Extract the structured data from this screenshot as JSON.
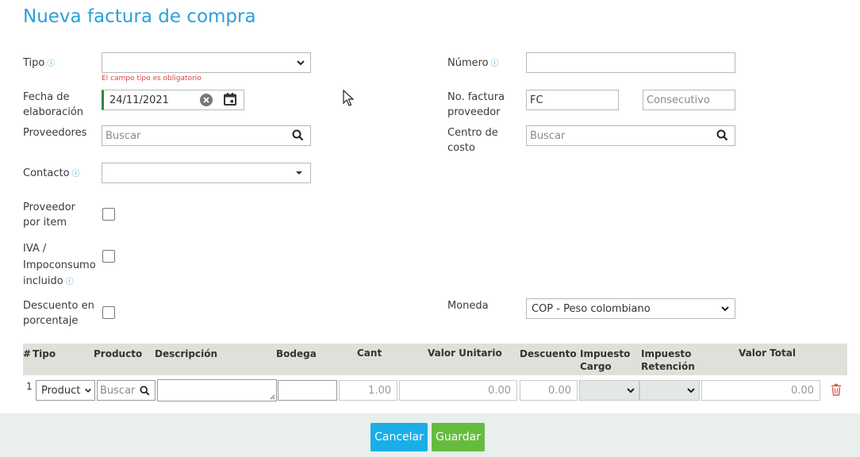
{
  "page": {
    "title": "Nueva factura de compra"
  },
  "form": {
    "tipo": {
      "label": "Tipo",
      "value": "",
      "error": "El campo tipo es obligatorio"
    },
    "fecha": {
      "label_line1": "Fecha de",
      "label_line2": "elaboración",
      "value": "24/11/2021"
    },
    "proveedores": {
      "label": "Proveedores",
      "placeholder": "Buscar"
    },
    "contacto": {
      "label": "Contacto",
      "value": ""
    },
    "proveedor_item": {
      "label_line1": "Proveedor",
      "label_line2": "por item",
      "checked": false
    },
    "iva": {
      "label_line1": "IVA /",
      "label_line2": "Impoconsumo",
      "label_line3": "incluido",
      "checked": false
    },
    "descuento_pct": {
      "label_line1": "Descuento en",
      "label_line2": "porcentaje",
      "checked": false
    },
    "numero": {
      "label": "Número",
      "value": ""
    },
    "no_factura": {
      "label_line1": "No. factura",
      "label_line2": "proveedor",
      "prefix": "FC",
      "placeholder": "Consecutivo"
    },
    "centro_costo": {
      "label_line1": "Centro de",
      "label_line2": "costo",
      "placeholder": "Buscar"
    },
    "moneda": {
      "label": "Moneda",
      "value": "COP - Peso colombiano"
    }
  },
  "table": {
    "headers": {
      "num": "#",
      "tipo": "Tipo",
      "producto": "Producto",
      "descripcion": "Descripción",
      "bodega": "Bodega",
      "cant": "Cant",
      "valor_unitario": "Valor Unitario",
      "descuento": "Descuento",
      "imp_cargo_1": "Impuesto",
      "imp_cargo_2": "Cargo",
      "imp_ret_1": "Impuesto",
      "imp_ret_2": "Retención",
      "valor_total": "Valor Total"
    },
    "rows": [
      {
        "num": "1",
        "tipo": "Product",
        "producto_placeholder": "Buscar",
        "cant": "1.00",
        "valor_unitario": "0.00",
        "descuento": "0.00",
        "valor_total": "0.00"
      }
    ]
  },
  "footer": {
    "cancel_label": "Cancelar",
    "save_label": "Guardar"
  },
  "colors": {
    "title": "#2c9fd9",
    "cancel": "#1aaee6",
    "save": "#66bb3f",
    "error": "#d9443a",
    "delete": "#e0564f"
  }
}
